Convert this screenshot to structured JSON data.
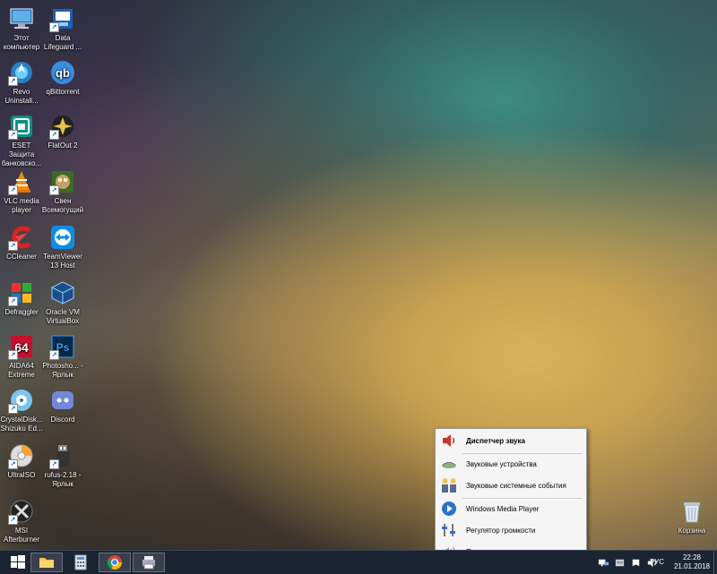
{
  "desktop_icons": [
    {
      "name": "this-pc",
      "label": "Этот компьютер",
      "icon": "computer-icon"
    },
    {
      "name": "data-lifeguard",
      "label": "Data Lifeguard ...",
      "icon": "data-lifeguard-icon"
    },
    {
      "name": "revo-uninstaller",
      "label": "Revo Uninstall...",
      "icon": "revo-icon"
    },
    {
      "name": "qbittorrent",
      "label": "qBittorrent",
      "icon": "qbittorrent-icon"
    },
    {
      "name": "eset",
      "label": "ESET Защита банковско...",
      "icon": "eset-icon"
    },
    {
      "name": "flatout2",
      "label": "FlatOut 2",
      "icon": "flatout-icon"
    },
    {
      "name": "vlc",
      "label": "VLC media player",
      "icon": "vlc-icon"
    },
    {
      "name": "sven",
      "label": "Свен Всемогущий",
      "icon": "sven-icon"
    },
    {
      "name": "ccleaner",
      "label": "CCleaner",
      "icon": "ccleaner-icon"
    },
    {
      "name": "teamviewer",
      "label": "TeamViewer 13 Host",
      "icon": "teamviewer-icon"
    },
    {
      "name": "defraggler",
      "label": "Defraggler",
      "icon": "defraggler-icon"
    },
    {
      "name": "virtualbox",
      "label": "Oracle VM VirtualBox",
      "icon": "virtualbox-icon"
    },
    {
      "name": "aida64",
      "label": "AIDA64 Extreme",
      "icon": "aida64-icon"
    },
    {
      "name": "photoshop",
      "label": "Photosho... - Ярлык",
      "icon": "photoshop-icon"
    },
    {
      "name": "crystaldisk",
      "label": "CrystalDisk... Shizuku Ed...",
      "icon": "crystaldisk-icon"
    },
    {
      "name": "discord",
      "label": "Discord",
      "icon": "discord-icon"
    },
    {
      "name": "ultraiso",
      "label": "UltraISO",
      "icon": "ultraiso-icon"
    },
    {
      "name": "rufus",
      "label": "rufus-2.18 - Ярлык",
      "icon": "rufus-icon"
    },
    {
      "name": "msi-afterburner",
      "label": "MSI Afterburner",
      "icon": "afterburner-icon"
    },
    {
      "name": "recycle-bin",
      "label": "Корзина",
      "icon": "recycle-bin-icon"
    }
  ],
  "context_menu": {
    "items": [
      {
        "label": "Диспетчер звука",
        "icon": "speaker-icon",
        "bold": true
      },
      {
        "label": "Звуковые устройства",
        "icon": "sound-devices-icon"
      },
      {
        "label": "Звуковые системные события",
        "icon": "system-sounds-icon"
      },
      {
        "label": "Windows Media Player",
        "icon": "media-player-icon"
      },
      {
        "label": "Регулятор громкости",
        "icon": "volume-mixer-icon"
      },
      {
        "label": "Программа записи звука",
        "icon": "sound-recorder-icon"
      }
    ]
  },
  "taskbar": {
    "pinned": [
      {
        "name": "start",
        "icon": "windows-logo-icon"
      },
      {
        "name": "file-explorer",
        "icon": "folder-icon"
      },
      {
        "name": "calculator",
        "icon": "calculator-icon"
      },
      {
        "name": "chrome",
        "icon": "chrome-icon"
      },
      {
        "name": "printer-app",
        "icon": "printer-icon"
      }
    ],
    "language": "РУС",
    "time": "22:28",
    "date": "21.01.2018"
  }
}
